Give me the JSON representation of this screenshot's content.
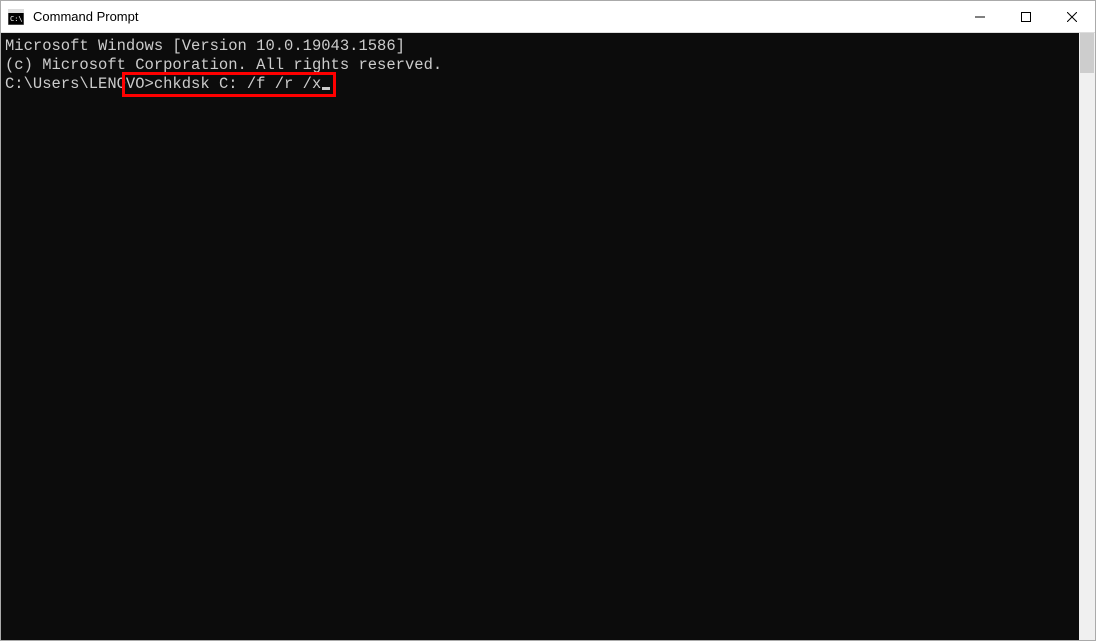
{
  "window": {
    "title": "Command Prompt"
  },
  "terminal": {
    "line1": "Microsoft Windows [Version 10.0.19043.1586]",
    "line2": "(c) Microsoft Corporation. All rights reserved.",
    "blank": "",
    "prompt": "C:\\Users\\LENOVO>",
    "command": "chkdsk C: /f /r /x"
  }
}
